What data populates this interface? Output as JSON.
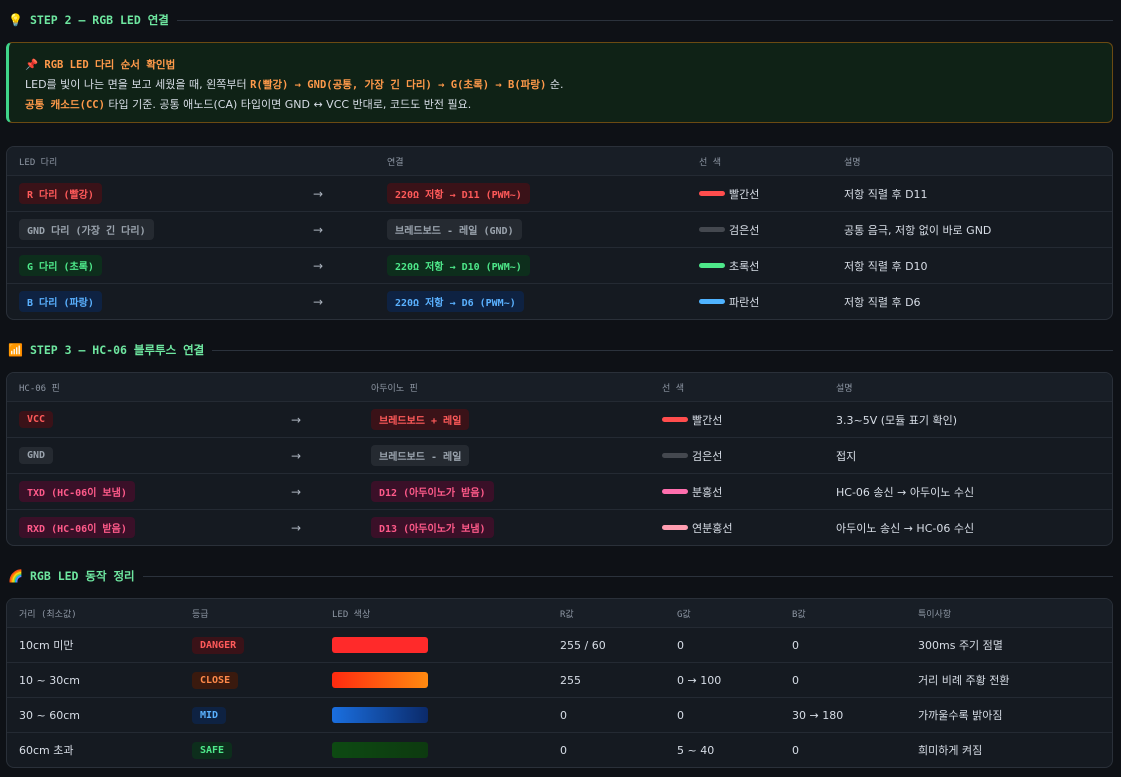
{
  "step2": {
    "icon": "💡",
    "title": "STEP 2 — RGB LED 연결",
    "note": {
      "title": "📌 RGB LED 다리 순서 확인법",
      "line1_a": "LED를 빛이 나는 면을 보고 세웠을 때, 왼쪽부터 ",
      "line1_hl": "R(빨강) → GND(공통, 가장 긴 다리) → G(초록) → B(파랑)",
      "line1_b": " 순.",
      "line2_hl": "공통 캐소드(CC)",
      "line2_b": " 타입 기준. 공통 애노드(CA) 타입이면 GND ↔ VCC 반대로, 코드도 반전 필요."
    },
    "headers": [
      "LED 다리",
      "연결",
      "선 색",
      "설명"
    ],
    "rows": [
      {
        "pin": "R 다리 (빨강)",
        "arrow": "→",
        "conn": "220Ω 저항 → D11 (PWM~)",
        "wire": "빨간선",
        "desc": "저항 직렬 후 D11",
        "pin_style": "red",
        "conn_style": "red",
        "wire_color": "#ff4d4d"
      },
      {
        "pin": "GND 다리 (가장 긴 다리)",
        "arrow": "→",
        "conn": "브레드보드 - 레일 (GND)",
        "wire": "검은선",
        "desc": "공통 음극, 저항 없이 바로 GND",
        "pin_style": "gray",
        "conn_style": "gray",
        "wire_color": "#44484f"
      },
      {
        "pin": "G 다리 (초록)",
        "arrow": "→",
        "conn": "220Ω 저항 → D10 (PWM~)",
        "wire": "초록선",
        "desc": "저항 직렬 후 D10",
        "pin_style": "green",
        "conn_style": "green",
        "wire_color": "#4ee88a"
      },
      {
        "pin": "B 다리 (파랑)",
        "arrow": "→",
        "conn": "220Ω 저항 → D6 (PWM~)",
        "wire": "파란선",
        "desc": "저항 직렬 후 D6",
        "pin_style": "blue",
        "conn_style": "blue",
        "wire_color": "#4fb3ff"
      }
    ]
  },
  "step3": {
    "icon": "📶",
    "title": "STEP 3 — HC-06 블루투스 연결",
    "headers": [
      "HC-06 핀",
      "아두이노 핀",
      "선 색",
      "설명"
    ],
    "rows": [
      {
        "pin": "VCC",
        "arrow": "→",
        "conn": "브레드보드 + 레일",
        "wire": "빨간선",
        "desc": "3.3~5V (모듈 표기 확인)",
        "pin_style": "red",
        "conn_style": "red",
        "wire_color": "#ff4d4d"
      },
      {
        "pin": "GND",
        "arrow": "→",
        "conn": "브레드보드 - 레일",
        "wire": "검은선",
        "desc": "접지",
        "pin_style": "gray",
        "conn_style": "gray",
        "wire_color": "#44484f"
      },
      {
        "pin": "TXD (HC-06이 보냄)",
        "arrow": "→",
        "conn": "D12 (아두이노가 받음)",
        "wire": "분홍선",
        "desc": "HC-06 송신 → 아두이노 수신",
        "pin_style": "pink",
        "conn_style": "pink",
        "wire_color": "#ff6fae"
      },
      {
        "pin": "RXD (HC-06이 받음)",
        "arrow": "→",
        "conn": "D13 (아두이노가 보냄)",
        "wire": "연분홍선",
        "desc": "아두이노 송신 → HC-06 수신",
        "pin_style": "pink",
        "conn_style": "pink",
        "wire_color": "#ff9db0"
      }
    ]
  },
  "summary": {
    "icon": "🌈",
    "title": "RGB LED 동작 정리",
    "headers": [
      "거리 (최소값)",
      "등급",
      "LED 색상",
      "R값",
      "G값",
      "B값",
      "특이사항"
    ],
    "rows": [
      {
        "dist": "10cm 미만",
        "grade": "DANGER",
        "grade_style": "red",
        "swatch": "linear-gradient(90deg,#ff2a2a,#ff2a2a)",
        "r": "255 / 60",
        "g": "0",
        "b": "0",
        "note": "300ms 주기 점멸"
      },
      {
        "dist": "10 ~ 30cm",
        "grade": "CLOSE",
        "grade_style": "orange",
        "swatch": "linear-gradient(90deg,#ff2a10,#ff8a10)",
        "r": "255",
        "g": "0 → 100",
        "b": "0",
        "note": "거리 비례 주황 전환"
      },
      {
        "dist": "30 ~ 60cm",
        "grade": "MID",
        "grade_style": "blue",
        "swatch": "linear-gradient(90deg,#1a6fe0,#0b2a6a)",
        "r": "0",
        "g": "0",
        "b": "30 → 180",
        "note": "가까울수록 밝아짐"
      },
      {
        "dist": "60cm 초과",
        "grade": "SAFE",
        "grade_style": "green",
        "swatch": "linear-gradient(90deg,#0d4a12,#0d3a10)",
        "r": "0",
        "g": "5 ~ 40",
        "b": "0",
        "note": "희미하게 켜짐"
      }
    ]
  }
}
